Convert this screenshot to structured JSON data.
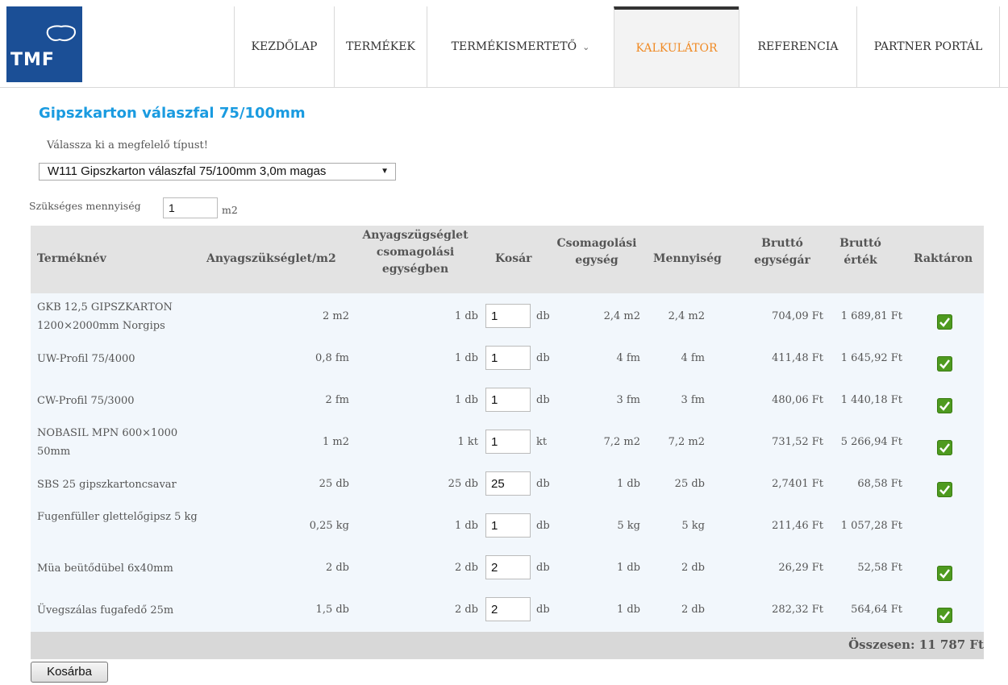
{
  "brand": {
    "logo_text": "TMF",
    "color": "#1b4f96"
  },
  "nav": {
    "items": [
      {
        "label": "KEZDŐLAP"
      },
      {
        "label": "TERMÉKEK"
      },
      {
        "label": "TERMÉKISMERTETŐ",
        "has_dropdown": true,
        "chevron": "⌄"
      },
      {
        "label": "KALKULÁTOR",
        "active": true
      },
      {
        "label": "REFERENCIA"
      },
      {
        "label": "PARTNER PORTÁL"
      }
    ],
    "active_color": "#f08a24"
  },
  "page": {
    "title": "Gipszkarton válaszfal 75/100mm",
    "title_color": "#1a9be0",
    "type_label": "Válassza ki a megfelelő típust!",
    "type_selected": "W111 Gipszkarton válaszfal 75/100mm 3,0m magas",
    "qty_label": "Szükséges mennyiség",
    "qty_value": "1",
    "qty_unit": "m2"
  },
  "table": {
    "headers": {
      "name": "Terméknév",
      "req": "Anyagszükséglet/m2",
      "req_pack_1": "Anyagszügséglet",
      "req_pack_2": "csomagolási",
      "req_pack_3": "egységben",
      "cart": "Kosár",
      "pack_1": "Csomagolási",
      "pack_2": "egység",
      "qty": "Mennyiség",
      "unit_price_1": "Bruttó",
      "unit_price_2": "egységár",
      "value_1": "Bruttó",
      "value_2": "érték",
      "stock": "Raktáron"
    },
    "rows": [
      {
        "name": "GKB 12,5 GIPSZKARTON 1200×2000mm Norgips",
        "req": "2 m2",
        "req_pack": "1 db",
        "cart": "1",
        "cart_unit": "db",
        "pack": "2,4 m2",
        "qty": "2,4 m2",
        "unit_price": "704,09 Ft",
        "value": "1 689,81 Ft",
        "in_stock": true
      },
      {
        "name": "UW-Profil 75/4000",
        "req": "0,8 fm",
        "req_pack": "1 db",
        "cart": "1",
        "cart_unit": "db",
        "pack": "4 fm",
        "qty": "4 fm",
        "unit_price": "411,48 Ft",
        "value": "1 645,92 Ft",
        "in_stock": true
      },
      {
        "name": "CW-Profil 75/3000",
        "req": "2 fm",
        "req_pack": "1 db",
        "cart": "1",
        "cart_unit": "db",
        "pack": "3 fm",
        "qty": "3 fm",
        "unit_price": "480,06 Ft",
        "value": "1 440,18 Ft",
        "in_stock": true
      },
      {
        "name": "NOBASIL MPN 600×1000 50mm",
        "req": "1 m2",
        "req_pack": "1 kt",
        "cart": "1",
        "cart_unit": "kt",
        "pack": "7,2 m2",
        "qty": "7,2 m2",
        "unit_price": "731,52 Ft",
        "value": "5 266,94 Ft",
        "in_stock": true
      },
      {
        "name": "SBS 25 gipszkartoncsavar",
        "req": "25 db",
        "req_pack": "25 db",
        "cart": "25",
        "cart_unit": "db",
        "pack": "1 db",
        "qty": "25 db",
        "unit_price": "2,7401 Ft",
        "value": "68,58 Ft",
        "in_stock": true
      },
      {
        "name": "Fugenfüller glettelőgipsz 5 kg",
        "req": "0,25 kg",
        "req_pack": "1 db",
        "cart": "1",
        "cart_unit": "db",
        "pack": "5 kg",
        "qty": "5 kg",
        "unit_price": "211,46 Ft",
        "value": "1 057,28 Ft",
        "in_stock": false
      },
      {
        "name": "Müa beütődübel 6x40mm",
        "req": "2 db",
        "req_pack": "2 db",
        "cart": "2",
        "cart_unit": "db",
        "pack": "1 db",
        "qty": "2 db",
        "unit_price": "26,29 Ft",
        "value": "52,58 Ft",
        "in_stock": true
      },
      {
        "name": "Üvegszálas fugafedő 25m",
        "req": "1,5 db",
        "req_pack": "2 db",
        "cart": "2",
        "cart_unit": "db",
        "pack": "1 db",
        "qty": "2 db",
        "unit_price": "282,32 Ft",
        "value": "564,64 Ft",
        "in_stock": true
      }
    ],
    "total": "Összesen: 11 787 Ft",
    "stock_color": "#4e9a1f"
  },
  "actions": {
    "cart_button": "Kosárba"
  }
}
